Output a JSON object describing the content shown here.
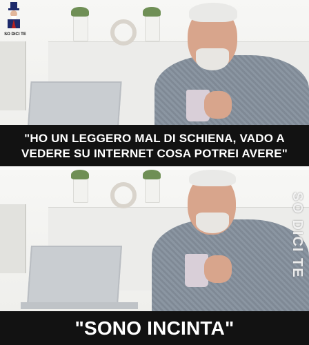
{
  "meme": {
    "top_caption_line1": "\"HO UN LEGGERO MAL DI SCHIENA, VADO A",
    "top_caption_line2": "VEDERE SU INTERNET COSA POTREI AVERE\"",
    "bottom_caption": "\"SONO INCINTA\"",
    "logo_text": "SO DICI TE",
    "watermark_text": "SO DICI TE"
  },
  "colors": {
    "caption_background": "#121212",
    "caption_text": "#ffffff"
  }
}
